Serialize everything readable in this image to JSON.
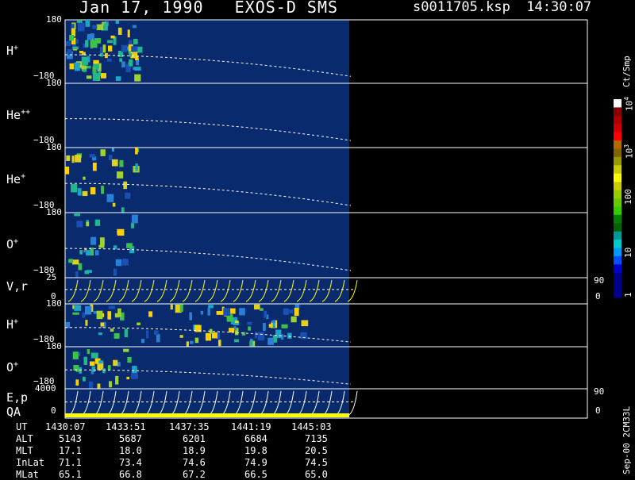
{
  "header": {
    "title": "Jan 17, 1990   EXOS-D SMS",
    "file_time": "s0011705.ksp  14:30:07"
  },
  "colors": {
    "background": "#000000",
    "panel_fill": "#0a2a6e",
    "trace": "#ffffff",
    "accent": "#ffff00"
  },
  "panels": [
    {
      "species_main": "H",
      "species_sup": "+",
      "top_tick": "180",
      "bottom_tick": "−180",
      "kind": "spectrogram"
    },
    {
      "species_main": "He",
      "species_sup": "++",
      "top_tick": "180",
      "bottom_tick": "−180",
      "kind": "spectrogram"
    },
    {
      "species_main": "He",
      "species_sup": "+",
      "top_tick": "180",
      "bottom_tick": "−180",
      "kind": "spectrogram"
    },
    {
      "species_main": "O",
      "species_sup": "+",
      "top_tick": "180",
      "bottom_tick": "−180",
      "kind": "spectrogram"
    },
    {
      "species_main": "V,r",
      "species_sup": "",
      "top_tick": "25",
      "bottom_tick": "0",
      "right_top": "90",
      "right_bottom": "0",
      "kind": "sweep"
    },
    {
      "species_main": "H",
      "species_sup": "+",
      "top_tick": "180",
      "bottom_tick": "−180",
      "kind": "spectrogram"
    },
    {
      "species_main": "O",
      "species_sup": "+",
      "top_tick": "180",
      "bottom_tick": "−180",
      "kind": "spectrogram"
    },
    {
      "species_main": "E,p",
      "species_sup": "",
      "species_extra": "QA",
      "top_tick": "4000",
      "bottom_tick": "0",
      "right_top": "90",
      "right_bottom": "0",
      "kind": "sweep"
    }
  ],
  "colorbar": {
    "unit": "Ct/Smp",
    "ticks": [
      "1",
      "10",
      "100",
      "10",
      "10"
    ],
    "tick_sups": [
      "",
      "",
      "",
      "3",
      "4"
    ],
    "colors": [
      "#00008b",
      "#00008b",
      "#00008b",
      "#0000cd",
      "#0050ff",
      "#0099ff",
      "#00cccc",
      "#009999",
      "#006400",
      "#008000",
      "#33cc00",
      "#66cc00",
      "#99cc00",
      "#cccc00",
      "#ffff00",
      "#cccc00",
      "#999900",
      "#806600",
      "#b36b00",
      "#ff0000",
      "#cc0000",
      "#aa0000",
      "#880000",
      "#ffffff"
    ]
  },
  "footer": {
    "rows": [
      {
        "label": "UT",
        "values": [
          "1430:07",
          "1433:51",
          "1437:35",
          "1441:19",
          "1445:03"
        ]
      },
      {
        "label": "ALT",
        "values": [
          "5143",
          "5687",
          "6201",
          "6684",
          "7135"
        ]
      },
      {
        "label": "MLT",
        "values": [
          "17.1",
          "18.0",
          "18.9",
          "19.8",
          "20.5"
        ]
      },
      {
        "label": "InLat",
        "values": [
          "71.1",
          "73.4",
          "74.6",
          "74.9",
          "74.5"
        ]
      },
      {
        "label": "MLat",
        "values": [
          "65.1",
          "66.8",
          "67.2",
          "66.5",
          "65.0"
        ]
      }
    ],
    "stamp": "Sep-00 2CM33L"
  },
  "chart_data": {
    "type": "heatmap",
    "title": "Jan 17, 1990   EXOS-D SMS",
    "subtitle": "s0011705.ksp  14:30:07",
    "x_ticks": [
      "1430:07",
      "1433:51",
      "1437:35",
      "1441:19",
      "1445:03"
    ],
    "series": [
      {
        "name": "H+",
        "ylim": [
          -180,
          180
        ]
      },
      {
        "name": "He++",
        "ylim": [
          -180,
          180
        ]
      },
      {
        "name": "He+",
        "ylim": [
          -180,
          180
        ]
      },
      {
        "name": "O+",
        "ylim": [
          -180,
          180
        ]
      },
      {
        "name": "V,r",
        "ylim": [
          0,
          25
        ]
      },
      {
        "name": "H+",
        "ylim": [
          -180,
          180
        ]
      },
      {
        "name": "O+",
        "ylim": [
          -180,
          180
        ]
      },
      {
        "name": "E,p",
        "ylim": [
          0,
          4000
        ]
      }
    ],
    "colorbar_label": "Ct/Smp",
    "colorbar_scale": "log"
  }
}
